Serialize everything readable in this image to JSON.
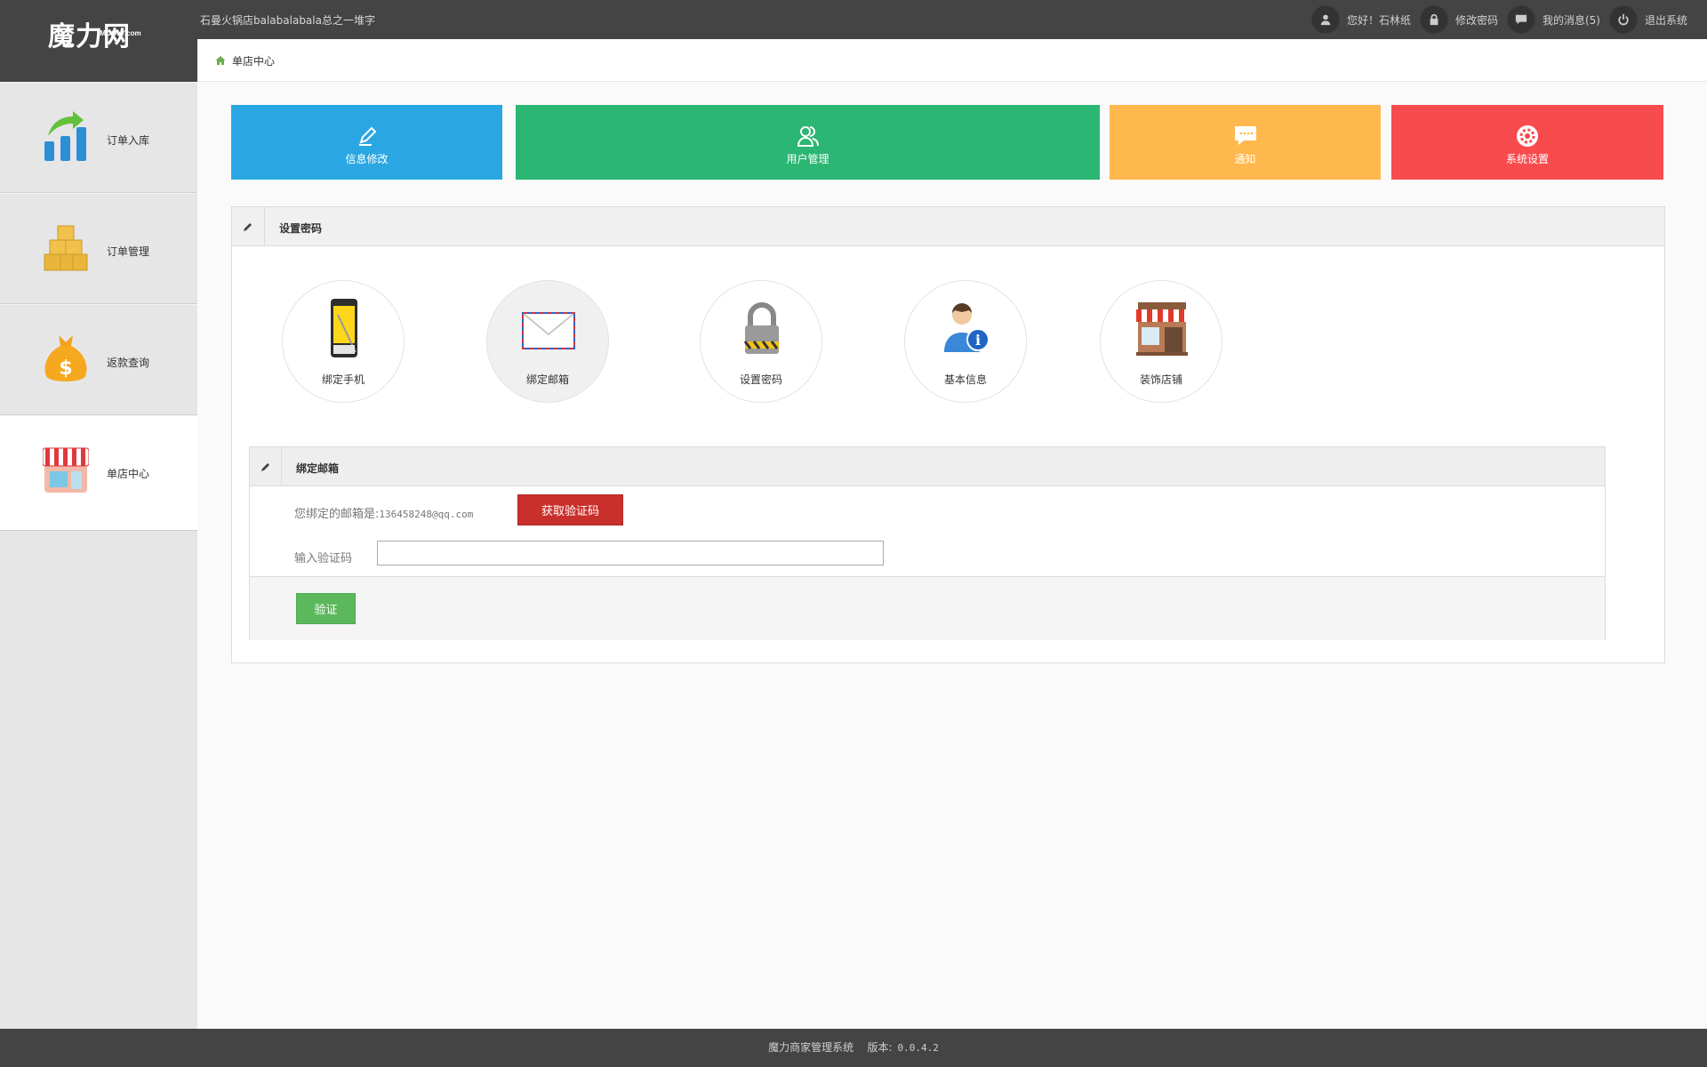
{
  "app": {
    "logo_text": "魔力网",
    "logo_sub": "IMOOLY.com",
    "shop_title": "石曼火锅店balabalabala总之一堆字"
  },
  "top_links": [
    {
      "label": "您好！石林纸",
      "icon": "user-icon"
    },
    {
      "label": "修改密码",
      "icon": "lock-icon"
    },
    {
      "label": "我的消息(5)",
      "icon": "message-icon"
    },
    {
      "label": "退出系统",
      "icon": "power-icon"
    }
  ],
  "breadcrumb": {
    "label": "单店中心",
    "icon": "home-icon"
  },
  "sidebar": {
    "items": [
      {
        "label": "订单入库",
        "icon": "bar-chart-icon"
      },
      {
        "label": "订单管理",
        "icon": "boxes-icon"
      },
      {
        "label": "返款查询",
        "icon": "money-bag-icon"
      },
      {
        "label": "单店中心",
        "icon": "store-icon",
        "active": true
      }
    ]
  },
  "tiles": [
    {
      "label": "信息修改",
      "icon": "pencil-icon",
      "color": "#2aa7e2"
    },
    {
      "label": "用户管理",
      "icon": "users-icon",
      "color": "#2bb673"
    },
    {
      "label": "通知",
      "icon": "chat-icon",
      "color": "#ffb84d"
    },
    {
      "label": "系统设置",
      "icon": "gear-icon",
      "color": "#f84b4e"
    }
  ],
  "panel": {
    "title": "设置密码",
    "circles": [
      {
        "label": "绑定手机",
        "icon": "phone-icon"
      },
      {
        "label": "绑定邮箱",
        "icon": "envelope-icon",
        "selected": true
      },
      {
        "label": "设置密码",
        "icon": "padlock-icon"
      },
      {
        "label": "基本信息",
        "icon": "user-info-icon"
      },
      {
        "label": "装饰店铺",
        "icon": "shop-front-icon"
      }
    ]
  },
  "bind_email": {
    "title": "绑定邮箱",
    "email_label": "您绑定的邮箱是:",
    "email_value": "136458248@qq.com",
    "get_code_label": "获取验证码",
    "code_label": "输入验证码",
    "code_value": "",
    "verify_label": "验证"
  },
  "footer": {
    "system_name": "魔力商家管理系统",
    "version_label": "版本:",
    "version": "0.0.4.2"
  }
}
